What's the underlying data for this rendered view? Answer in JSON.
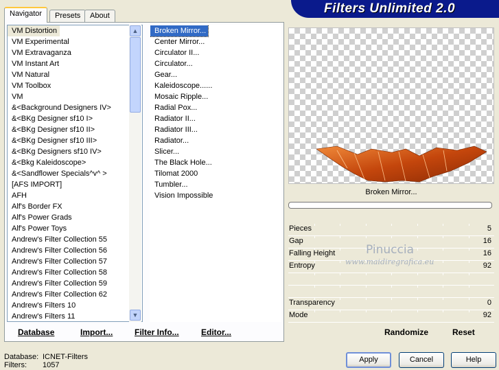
{
  "banner": {
    "title": "Filters Unlimited 2.0"
  },
  "tabs": [
    {
      "label": "Navigator",
      "active": true
    },
    {
      "label": "Presets",
      "active": false
    },
    {
      "label": "About",
      "active": false
    }
  ],
  "categories": [
    "VM Distortion",
    "VM Experimental",
    "VM Extravaganza",
    "VM Instant Art",
    "VM Natural",
    "VM Toolbox",
    "VM",
    "&<Background Designers IV>",
    "&<BKg Designer sf10 I>",
    "&<BKg Designer sf10 II>",
    "&<BKg Designer sf10 III>",
    "&<BKg Designers sf10 IV>",
    "&<Bkg Kaleidoscope>",
    "&<Sandflower Specials^v^ >",
    "[AFS IMPORT]",
    "AFH",
    "Alf's Border FX",
    "Alf's Power Grads",
    "Alf's Power Toys",
    "Andrew's Filter Collection 55",
    "Andrew's Filter Collection 56",
    "Andrew's Filter Collection 57",
    "Andrew's Filter Collection 58",
    "Andrew's Filter Collection 59",
    "Andrew's Filter Collection 62",
    "Andrew's Filters 10",
    "Andrew's Filters 11"
  ],
  "selected_category": "VM Distortion",
  "filters": [
    "Broken Mirror...",
    "Center Mirror...",
    "Circulator II...",
    "Circulator...",
    "Gear...",
    "Kaleidoscope......",
    "Mosaic Ripple...",
    "Radial Pox...",
    "Radiator II...",
    "Radiator III...",
    "Radiator...",
    "Slicer...",
    "The Black Hole...",
    "Tilomat 2000",
    "Tumbler...",
    "Vision Impossible"
  ],
  "selected_filter": "Broken Mirror...",
  "panel_buttons": {
    "database": "Database",
    "import": "Import...",
    "filter_info": "Filter Info...",
    "editor": "Editor...",
    "randomize": "Randomize",
    "reset": "Reset"
  },
  "preview": {
    "filter_title": "Broken Mirror..."
  },
  "params": [
    {
      "name": "Pieces",
      "value": "5"
    },
    {
      "name": "Gap",
      "value": "16"
    },
    {
      "name": "Falling Height",
      "value": "16"
    },
    {
      "name": "Entropy",
      "value": "92"
    },
    {
      "name": "",
      "value": ""
    },
    {
      "name": "",
      "value": ""
    },
    {
      "name": "Transparency",
      "value": "0"
    },
    {
      "name": "Mode",
      "value": "92"
    }
  ],
  "watermark": {
    "line1": "Pinuccia",
    "line2": "www.maidiregrafica.eu"
  },
  "status": {
    "database_label": "Database:",
    "database_value": "ICNET-Filters",
    "filters_label": "Filters:",
    "filters_value": "1057"
  },
  "dialog_buttons": {
    "apply": "Apply",
    "cancel": "Cancel",
    "help": "Help"
  }
}
